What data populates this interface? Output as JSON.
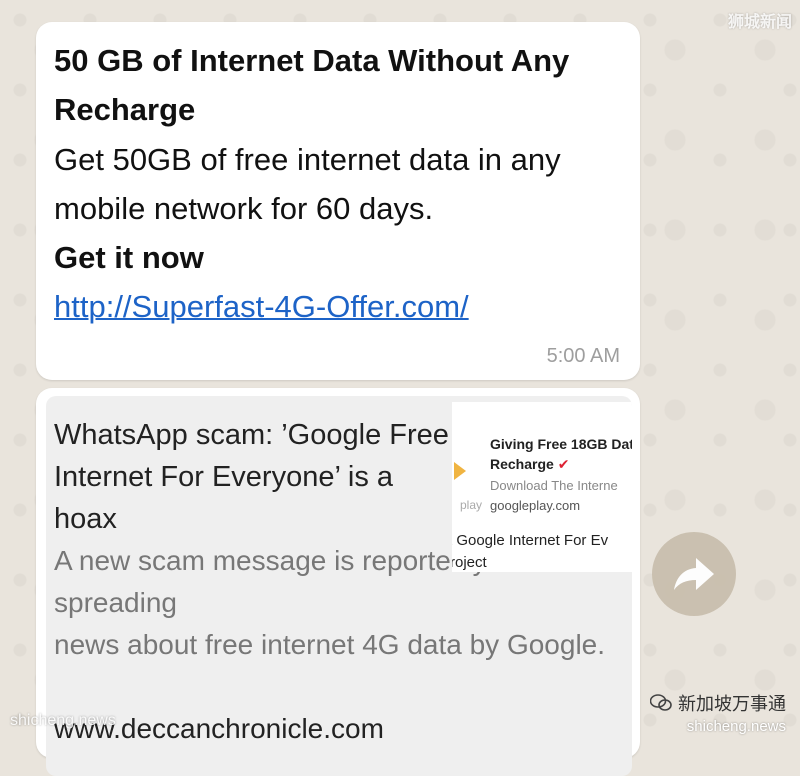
{
  "messages": [
    {
      "title": "50 GB of Internet Data Without Any Recharge",
      "body": "Get 50GB of free internet data in any mobile network for 60 days.",
      "cta": "Get it now",
      "link": "http://Superfast-4G-Offer.com/",
      "time": "5:00 AM"
    }
  ],
  "forwarded": {
    "title": "WhatsApp scam: ’Google Free Internet For Everyone’ is a hoax",
    "description_line1": "A new scam message is reportedly spreading",
    "description_line2": "news about free internet 4G data by Google.",
    "site": "www.deccanchronicle.com",
    "thumbnail": {
      "line1": "Giving Free 18GB Dat",
      "line2": "Recharge",
      "line3": "Download The Interne",
      "line4_prefix": "play",
      "line4": "googleplay.com",
      "line5": "t Google Internet For Ev",
      "line6": "roject"
    }
  },
  "share_button": {
    "icon": "forward-arrow-icon"
  },
  "watermarks": {
    "top_right": "狮城新闻",
    "bottom_left": "shicheng.news",
    "bottom_right_cn": "新加坡万事通",
    "bottom_right_en": "shicheng.news"
  },
  "colors": {
    "link": "#1d63c7",
    "timestamp": "#9e9e9e",
    "background": "#e9e4dc"
  }
}
